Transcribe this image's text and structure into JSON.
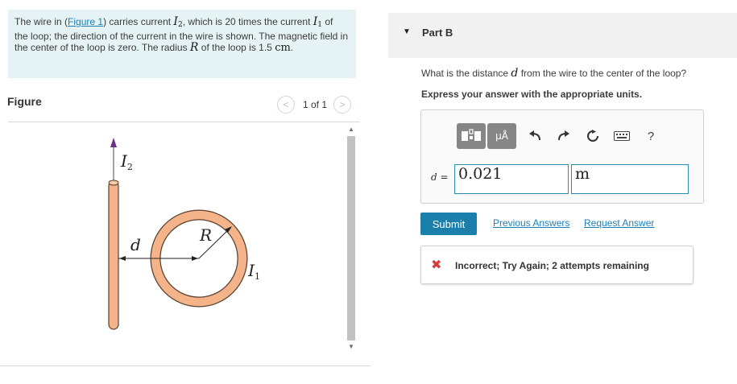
{
  "problem": {
    "t1": "The wire in (",
    "figure_link": "Figure 1",
    "t2": ") carries current ",
    "var_I": "I",
    "sub_2": "2",
    "t3": ", which is 20 times the current",
    "sub_1": "1",
    "t4": " of the loop; the direction of the current in the wire is shown. The magnetic field in the center of the loop is zero. The radius ",
    "var_R": "R",
    "t5": " of the loop is 1.5 ",
    "unit_cm": "cm",
    "t6": "."
  },
  "figure": {
    "title": "Figure",
    "pager_prev": "<",
    "pager_text": "1 of 1",
    "pager_next": ">",
    "label_I2_var": "I",
    "label_I2_sub": "2",
    "label_d": "d",
    "label_R": "R",
    "label_I1_var": "I",
    "label_I1_sub": "1",
    "colors": {
      "wire": "#f5b38a",
      "loop": "#f5b38a",
      "outline": "#5a4030",
      "arrow_up": "#6b2f8e"
    }
  },
  "part": {
    "caret": "▼",
    "title": "Part B",
    "question_pre": "What is the distance ",
    "question_var": "d",
    "question_post": " from the wire to the center of the loop?",
    "instruction": "Express your answer with the appropriate units.",
    "toolbar": {
      "mu_label": "μÅ",
      "help": "?"
    },
    "answer_var": "d",
    "answer_eq": " =",
    "value": "0.021",
    "unit": "m",
    "submit": "Submit",
    "previous_answers": "Previous Answers",
    "request_answer": "Request Answer",
    "feedback_icon": "✖",
    "feedback": "Incorrect; Try Again; 2 attempts remaining"
  }
}
